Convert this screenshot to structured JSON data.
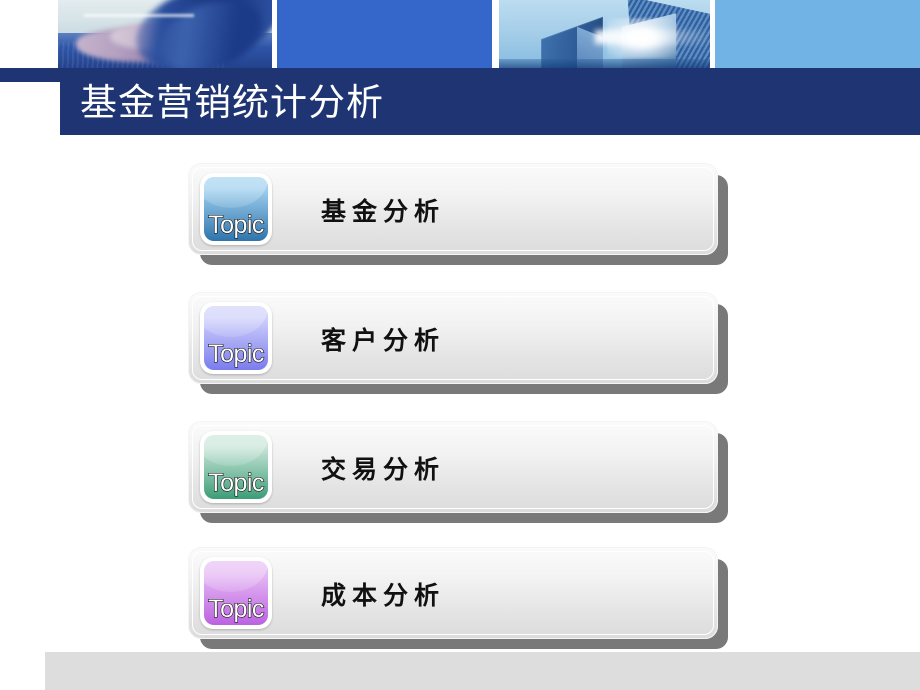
{
  "slide": {
    "title": "基金营销统计分析",
    "background_color": "#ffffff",
    "title_bar_color": "#1e3473",
    "footer_color": "#dddddd"
  },
  "header": {
    "panels": [
      {
        "name": "keyboard-photo",
        "type": "image",
        "description": "blurred hands typing on keyboard",
        "color": "#2f55a8"
      },
      {
        "name": "solid-blue-panel",
        "type": "solid",
        "color": "#3567cb"
      },
      {
        "name": "skyscraper-photo",
        "type": "image",
        "description": "skyscrapers looking up toward the sun",
        "color": "#a6cfe9"
      },
      {
        "name": "light-blue-panel",
        "type": "solid",
        "color": "#71b3e4"
      }
    ]
  },
  "topics": [
    {
      "badge_label": "Topic",
      "title": "基金分析",
      "badge_color_top": "#9fd0ef",
      "badge_color_bottom": "#2f74ab"
    },
    {
      "badge_label": "Topic",
      "title": "客户分析",
      "badge_color_top": "#cfd0fb",
      "badge_color_bottom": "#7b7cec"
    },
    {
      "badge_label": "Topic",
      "title": "交易分析",
      "badge_color_top": "#c9e6d9",
      "badge_color_bottom": "#3c9d77"
    },
    {
      "badge_label": "Topic",
      "title": "成本分析",
      "badge_color_top": "#e6bbf4",
      "badge_color_bottom": "#bb62e0"
    }
  ]
}
